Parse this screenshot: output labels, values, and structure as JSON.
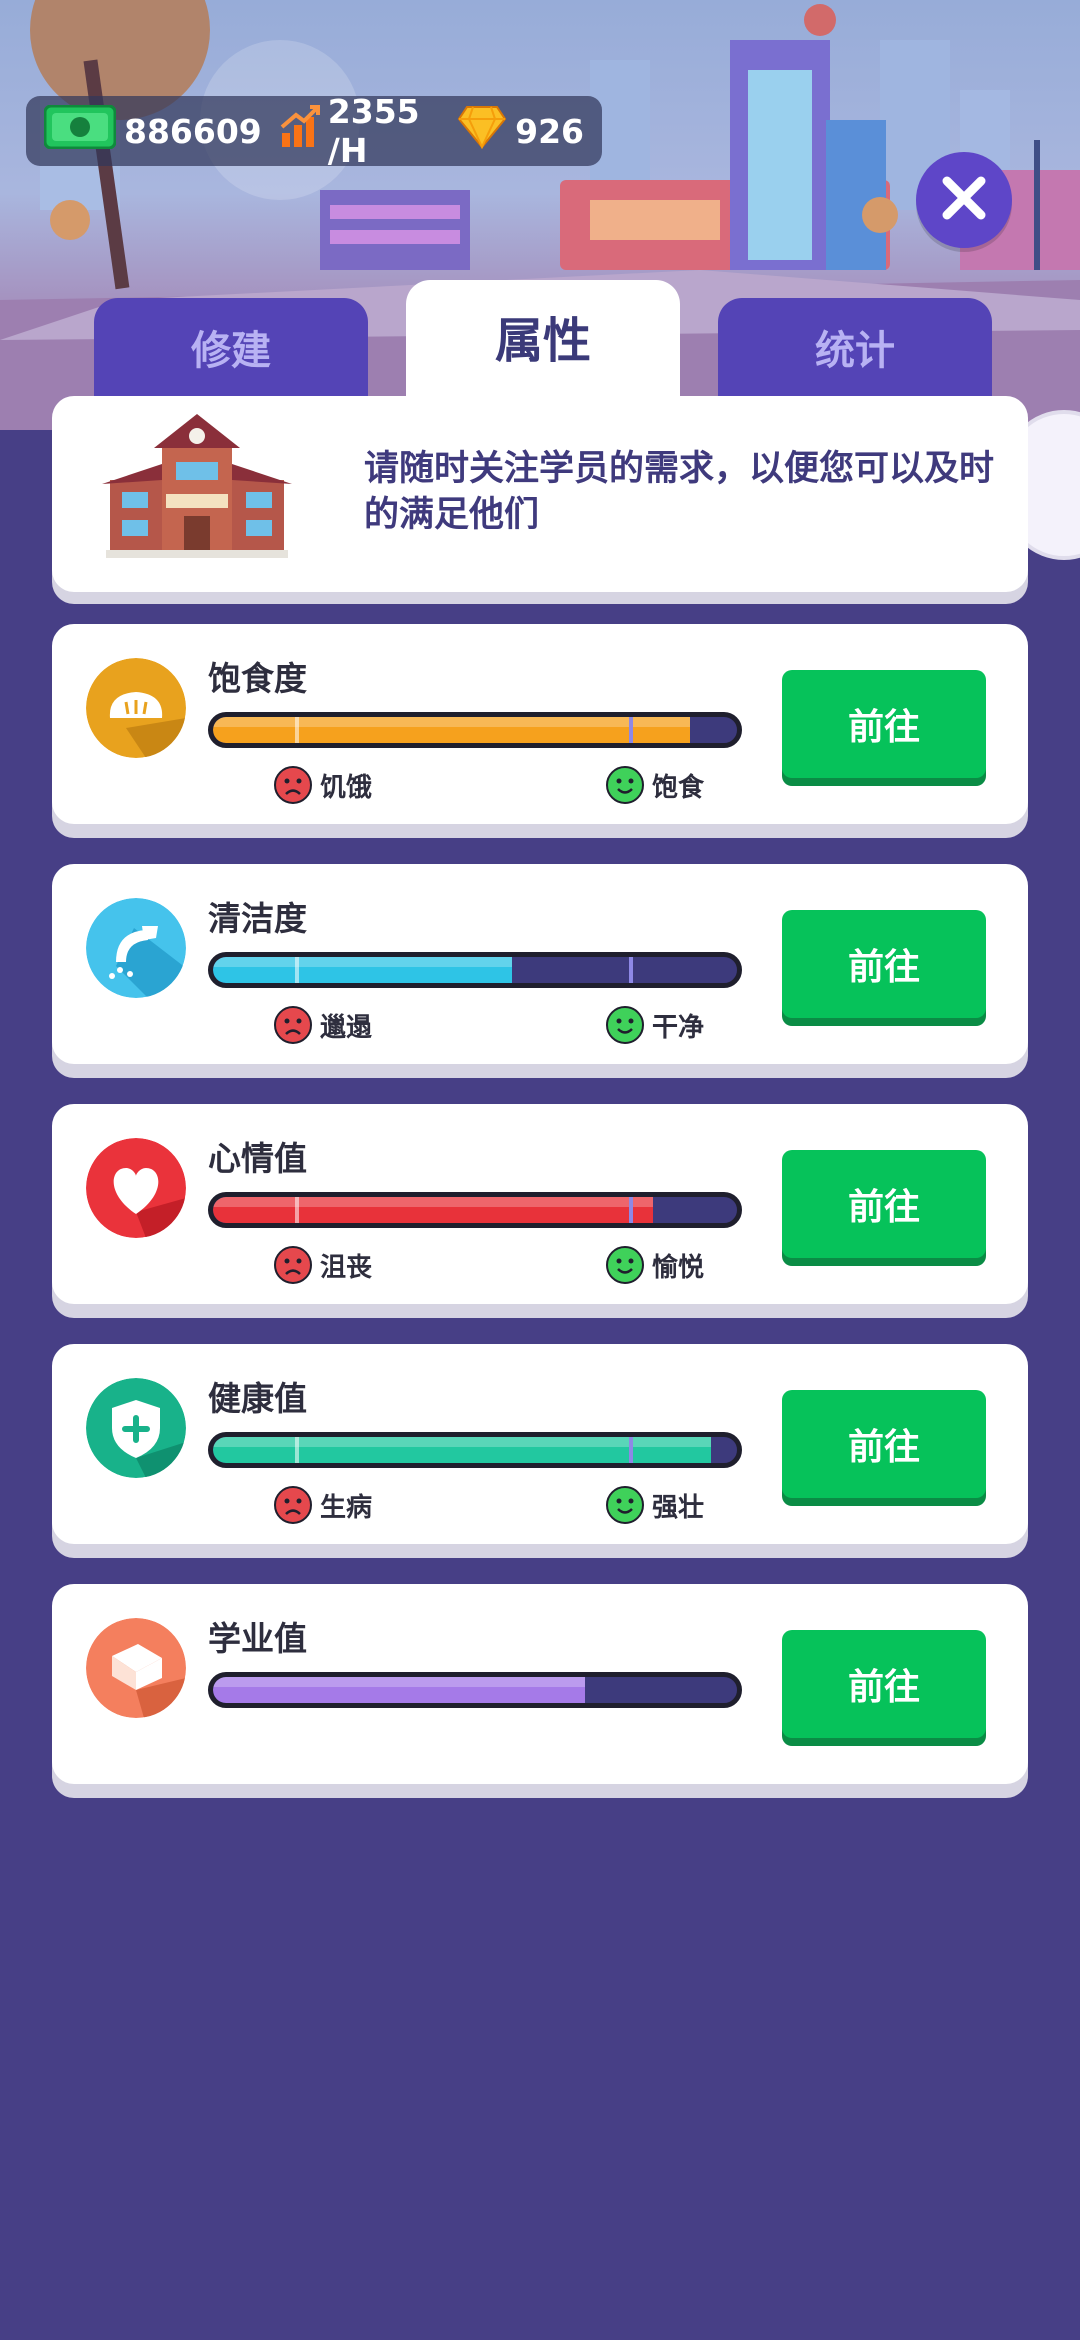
{
  "resources": {
    "cash": "886609",
    "income": "2355 /H",
    "gems": "926"
  },
  "tabs": [
    {
      "label": "修建",
      "active": false
    },
    {
      "label": "属性",
      "active": true
    },
    {
      "label": "统计",
      "active": false
    }
  ],
  "info": {
    "text": "请随时关注学员的需求，以便您可以及时的满足他们"
  },
  "stats": [
    {
      "title": "饱食度",
      "low_label": "饥饿",
      "high_label": "饱食",
      "value": 0.91,
      "button": "前往",
      "color": "#f6a11d",
      "icon": "bread-icon"
    },
    {
      "title": "清洁度",
      "low_label": "邋遢",
      "high_label": "干净",
      "value": 0.57,
      "button": "前往",
      "color": "#2ec4e6",
      "icon": "shower-icon"
    },
    {
      "title": "心情值",
      "low_label": "沮丧",
      "high_label": "愉悦",
      "value": 0.84,
      "button": "前往",
      "color": "#e8323a",
      "icon": "heart-icon"
    },
    {
      "title": "健康值",
      "low_label": "生病",
      "high_label": "强壮",
      "value": 0.95,
      "button": "前往",
      "color": "#22c8a0",
      "icon": "shield-plus-icon"
    },
    {
      "title": "学业值",
      "value": 0.71,
      "button": "前往",
      "color": "#a57ae8",
      "icon": "book-icon"
    }
  ]
}
